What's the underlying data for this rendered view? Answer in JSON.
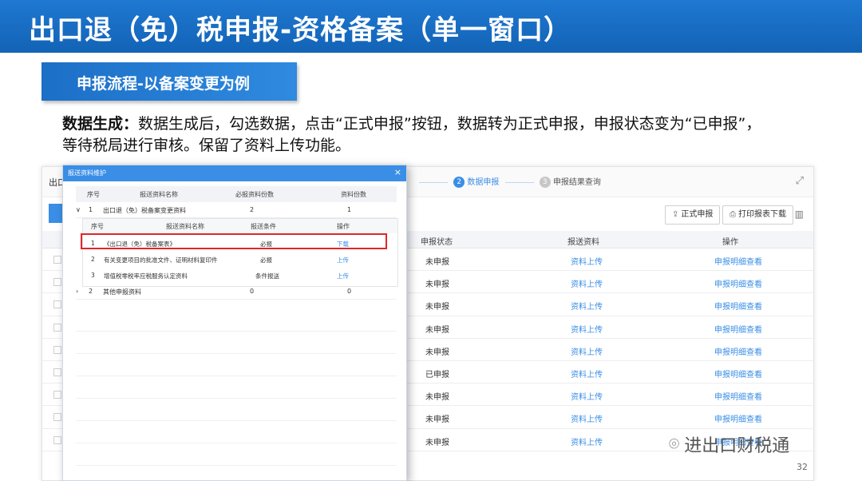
{
  "title": "出口退（免）税申报-资格备案（单一窗口）",
  "section_tag": "申报流程-以备案变更为例",
  "description": {
    "lead": "数据生成：",
    "body": "数据生成后，勾选数据，点击“正式申报”按钮，数据转为正式申报，申报状态变为“已申报”，等待税局进行审核。保留了资料上传功能。"
  },
  "background_window": {
    "crumb_left": "出口",
    "steps": [
      {
        "num": "2",
        "label": "数据申报",
        "active": true
      },
      {
        "num": "3",
        "label": "申报结果查询",
        "active": false
      }
    ],
    "buttons": {
      "formal": "正式申报",
      "print": "打印报表下载"
    },
    "columns": {
      "status": "申报状态",
      "materials": "报送资料",
      "action": "操作"
    },
    "rows": [
      {
        "status": "未申报",
        "upload": "资料上传",
        "view": "申报明细查看"
      },
      {
        "status": "未申报",
        "upload": "资料上传",
        "view": "申报明细查看"
      },
      {
        "status": "未申报",
        "upload": "资料上传",
        "view": "申报明细查看"
      },
      {
        "status": "未申报",
        "upload": "资料上传",
        "view": "申报明细查看"
      },
      {
        "status": "未申报",
        "upload": "资料上传",
        "view": "申报明细查看"
      },
      {
        "status": "已申报",
        "upload": "资料上传",
        "view": "申报明细查看"
      },
      {
        "status": "未申报",
        "upload": "资料上传",
        "view": "申报明细查看"
      },
      {
        "status": "未申报",
        "upload": "资料上传",
        "view": "申报明细查看"
      },
      {
        "status": "未申报",
        "upload": "资料上传",
        "view": "申报明细查看"
      }
    ]
  },
  "modal": {
    "title": "报送资料维护",
    "close": "×",
    "columns": {
      "seq": "序号",
      "name": "报送资料名称",
      "required": "必报资料份数",
      "count": "资料份数"
    },
    "groups": [
      {
        "seq": "1",
        "name": "出口退（免）税备案变更资料",
        "required": "2",
        "count": "1"
      },
      {
        "seq": "2",
        "name": "其他申报资料",
        "required": "0",
        "count": "0"
      }
    ],
    "sub": {
      "columns": {
        "seq": "序号",
        "name": "报送资料名称",
        "cond": "报送条件",
        "op": "操作"
      },
      "rows": [
        {
          "seq": "1",
          "name": "《出口退（免）税备案表》",
          "cond": "必报",
          "op": "下载"
        },
        {
          "seq": "2",
          "name": "有关变更项目的批准文件、证明材料复印件",
          "cond": "必报",
          "op": "上传"
        },
        {
          "seq": "3",
          "name": "增值税零税率应税服务认定资料",
          "cond": "条件报送",
          "op": "上传"
        }
      ]
    }
  },
  "watermark": "进出口财税通",
  "page_number": "32",
  "colors": {
    "brand_blue": "#1263b6",
    "link_blue": "#3a8ee6",
    "highlight_red": "#e0262b"
  }
}
